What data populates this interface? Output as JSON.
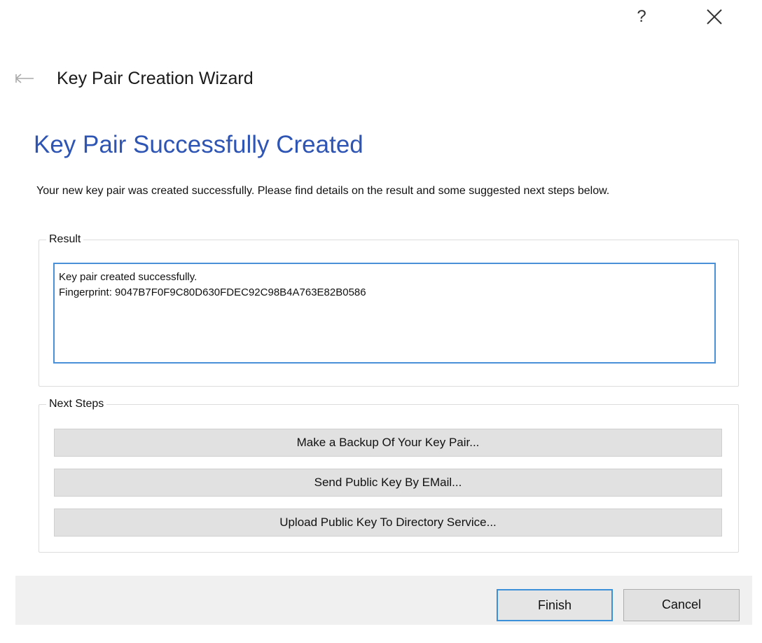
{
  "titlebar": {
    "help_label": "?"
  },
  "wizard": {
    "title": "Key Pair Creation Wizard"
  },
  "page": {
    "title": "Key Pair Successfully Created",
    "intro": "Your new key pair was created successfully. Please find details on the result and some suggested next steps below."
  },
  "result": {
    "legend": "Result",
    "lines": [
      "Key pair created successfully.",
      "Fingerprint: 9047B7F0F9C80D630FDEC92C98B4A763E82B0586"
    ]
  },
  "next_steps": {
    "legend": "Next Steps",
    "buttons": [
      "Make a Backup Of Your Key Pair...",
      "Send Public Key By EMail...",
      "Upload Public Key To Directory Service..."
    ]
  },
  "footer": {
    "finish_label": "Finish",
    "cancel_label": "Cancel"
  },
  "colors": {
    "accent": "#2e55b4",
    "focus_border": "#3c8fd9",
    "footer_bg": "#f0f0f0"
  },
  "icons": {
    "back": "back-arrow-icon",
    "close": "close-icon"
  }
}
